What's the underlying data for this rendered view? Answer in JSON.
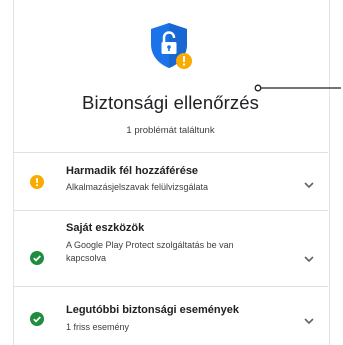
{
  "header": {
    "title": "Biztonsági ellenőrzés",
    "subtitle": "1 problémát találtunk"
  },
  "colors": {
    "shield_blue": "#1a73e8",
    "warning": "#f9ab00",
    "ok": "#1e8e3e"
  },
  "items": [
    {
      "title": "Harmadik fél hozzáférése",
      "description": "Alkalmazásjelszavak felülvizsgálata",
      "status": "warning",
      "icon": "warning-icon"
    },
    {
      "title": "Saját eszközök",
      "description": "A Google Play Protect szolgáltatás be van kapcsolva",
      "status": "ok",
      "icon": "check-icon"
    },
    {
      "title": "Legutóbbi biztonsági események",
      "description": "1 friss esemény",
      "status": "ok",
      "icon": "check-icon"
    }
  ]
}
